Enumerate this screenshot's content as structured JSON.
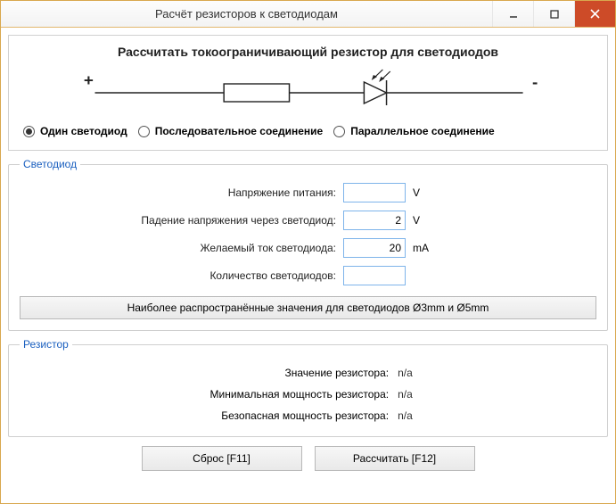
{
  "window": {
    "title": "Расчёт резисторов к светодиодам"
  },
  "panel": {
    "heading": "Рассчитать токоограничивающий резистор для светодиодов",
    "plus": "+",
    "minus": "-"
  },
  "modes": {
    "single": "Один светодиод",
    "series": "Последовательное соединение",
    "parallel": "Параллельное соединение",
    "selected": "single"
  },
  "led_group": {
    "legend": "Светодиод",
    "rows": {
      "supply": {
        "label": "Напряжение питания:",
        "value": "",
        "unit": "V"
      },
      "drop": {
        "label": "Падение напряжения через светодиод:",
        "value": "2",
        "unit": "V"
      },
      "current": {
        "label": "Желаемый ток светодиода:",
        "value": "20",
        "unit": "mA"
      },
      "count": {
        "label": "Количество светодиодов:",
        "value": "",
        "unit": ""
      }
    },
    "common_btn": "Наиболее распространённые значения для светодиодов Ø3mm и Ø5mm"
  },
  "res_group": {
    "legend": "Резистор",
    "rows": {
      "value": {
        "label": "Значение резистора:",
        "value": "n/a"
      },
      "min_pow": {
        "label": "Минимальная мощность резистора:",
        "value": "n/a"
      },
      "safe_pow": {
        "label": "Безопасная мощность резистора:",
        "value": "n/a"
      }
    }
  },
  "buttons": {
    "reset": "Сброс [F11]",
    "calc": "Рассчитать [F12]"
  }
}
